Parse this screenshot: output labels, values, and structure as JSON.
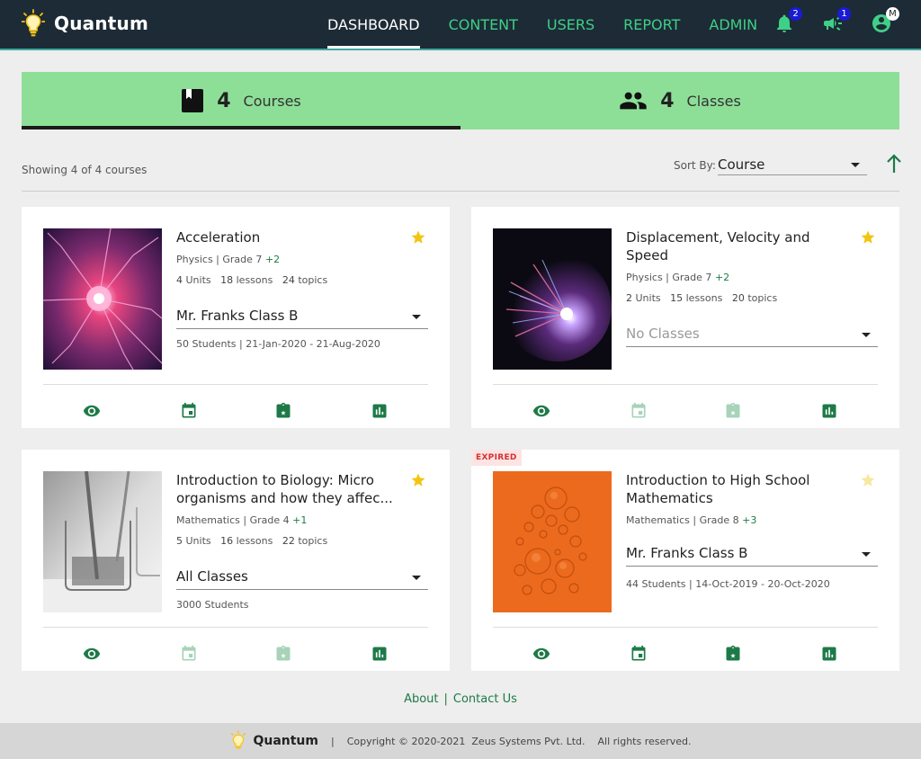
{
  "header": {
    "brand": "Quantum",
    "nav": [
      "DASHBOARD",
      "CONTENT",
      "USERS",
      "REPORT",
      "ADMIN"
    ],
    "notifications_badge": "2",
    "announcements_badge": "1",
    "profile_badge": "M"
  },
  "summary": {
    "courses_count": "4",
    "courses_label": "Courses",
    "classes_count": "4",
    "classes_label": "Classes"
  },
  "toolbar": {
    "showing": "Showing 4 of 4 courses",
    "sort_label": "Sort By:",
    "sort_value": "Course"
  },
  "cards": [
    {
      "title": "Acceleration",
      "subject": "Physics",
      "grade": "Grade 7",
      "grade_extra": "+2",
      "units": "4",
      "lessons": "18",
      "topics": "24",
      "class_select": "Mr. Franks Class B",
      "stats": "50 Students | 21-Jan-2020 - 21-Aug-2020",
      "starred": true
    },
    {
      "title": "Displacement, Velocity and Speed",
      "subject": "Physics",
      "grade": "Grade 7",
      "grade_extra": "+2",
      "units": "2",
      "lessons": "15",
      "topics": "20",
      "class_select": "No Classes",
      "stats": "",
      "starred": true
    },
    {
      "title": "Introduction to Biology: Micro organisms and how they affec...",
      "subject": "Mathematics",
      "grade": "Grade 4",
      "grade_extra": "+1",
      "units": "5",
      "lessons": "16",
      "topics": "22",
      "class_select": "All Classes",
      "stats": "3000 Students",
      "starred": true
    },
    {
      "badge": "EXPIRED",
      "title": "Introduction to High School Mathematics",
      "subject": "Mathematics",
      "grade": "Grade 8",
      "grade_extra": "+3",
      "units": "",
      "lessons": "",
      "topics": "",
      "class_select": "Mr. Franks Class B",
      "stats": "44 Students | 14-Oct-2019 - 20-Oct-2020",
      "starred": false
    }
  ],
  "labels": {
    "units": "Units",
    "lessons": "lessons",
    "topics": "topics"
  },
  "footer": {
    "about": "About",
    "contact": "Contact Us",
    "brand": "Quantum",
    "copyright": "Copyright © 2020-2021  Zeus Systems Pvt. Ltd.    All rights reserved."
  },
  "colors": {
    "header_bg": "#1d2b36",
    "accent_green": "#3fcf87",
    "summary_bg": "#8ddf98",
    "action_green": "#1d7a47",
    "star_gold": "#f2c511"
  },
  "icons": {
    "brand": "lightbulb-icon",
    "courses": "book-icon",
    "classes": "people-icon",
    "sort_direction": "arrow-up-icon",
    "notifications": "bell-icon",
    "announcements": "megaphone-icon",
    "profile": "account-icon",
    "card_actions": [
      "eye-icon",
      "calendar-icon",
      "assignment-star-icon",
      "bar-chart-icon"
    ]
  }
}
